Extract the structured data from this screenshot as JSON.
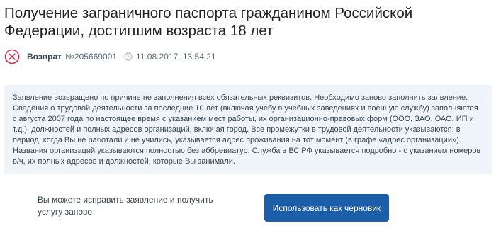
{
  "page": {
    "title": "Получение заграничного паспорта гражданином Российской Федерации, достигшим возраста 18 лет"
  },
  "status": {
    "icon": "x-circle-icon",
    "icon_color": "#d0314b",
    "label": "Возврат",
    "number": "№205669001",
    "datetime": "11.08.2017, 13:54:21"
  },
  "notice": {
    "background": "#eef4f9",
    "text": "Заявление возвращено по причине не заполнения всех обязательных реквизитов. Необходимо заново заполнить заявление. Сведения о трудовой деятельности за последние 10 лет (включая учебу в учебных заведениях и военную службу) заполняются с августа 2007 года по настоящее время с указанием мест работы, их организационно-правовых форм (ООО, ЗАО, ОАО, ИП и т.д.), должностей и полных адресов организаций, включая город. Все промежутки в трудовой деятельности указываются: в период, когда Вы не работали и не учились, указывается адрес проживания на тот момент (в графе «адрес организации»). Названия организаций указываются полностью без аббревиатур. Служба в ВС РФ указывается подробно - с указанием номеров в/ч, их полных адресов и должностей, которые Вы занимали."
  },
  "footer": {
    "text": "Вы можете исправить заявление и получить услугу заново",
    "button_label": "Использовать как черновик",
    "button_color": "#1d5ea8"
  }
}
